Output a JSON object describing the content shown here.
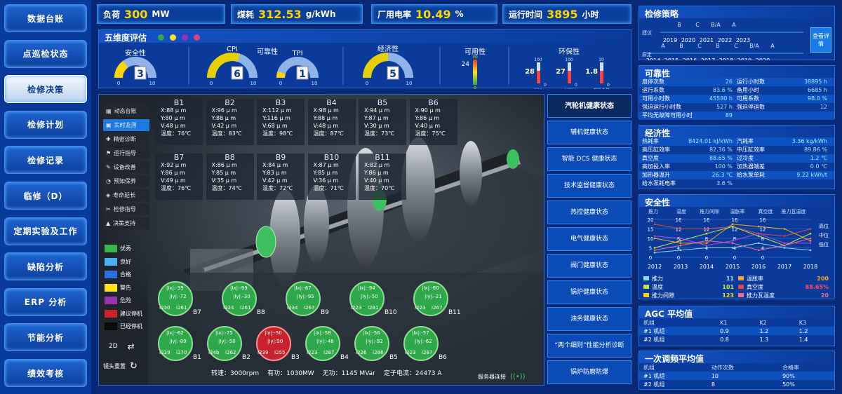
{
  "nav": [
    "数据台账",
    "点巡检状态",
    "检修决策",
    "检修计划",
    "检修记录",
    "临修（D）",
    "定期实验及工作",
    "缺陷分析",
    "ERP 分析",
    "节能分析",
    "绩效考核"
  ],
  "nav_active": 2,
  "metrics": [
    {
      "label": "负荷",
      "value": "300",
      "unit": "MW"
    },
    {
      "label": "煤耗",
      "value": "312.53",
      "unit": "g/kWh"
    },
    {
      "label": "厂用电率",
      "value": "10.49",
      "unit": "%"
    },
    {
      "label": "运行时间",
      "value": "3895",
      "unit": "小时"
    }
  ],
  "five": {
    "title": "五维度评估",
    "dots": [
      "#2fa84a",
      "#ffe21a",
      "#9b2fb5",
      "#e0407a"
    ],
    "safety": {
      "label": "安全性",
      "value": "3",
      "min": "0",
      "max": "10",
      "level": 0.3
    },
    "reliability": {
      "label": "可靠性",
      "cpi_label": "CPI",
      "cpi": "6",
      "tpi_label": "TPI",
      "tpi": "1",
      "min": "0",
      "max": "10",
      "cpi_level": 0.6,
      "tpi_level": 0.1
    },
    "economy": {
      "label": "经济性",
      "value": "5",
      "min": "0",
      "max": "10",
      "level": 0.5
    },
    "availability": {
      "label": "可用性",
      "value": "24",
      "top": "30",
      "bottom": "0",
      "level": 0.8
    },
    "env": {
      "label": "环保性",
      "items": [
        {
          "name": "SO2",
          "value": "28",
          "max": "100",
          "min": "0"
        },
        {
          "name": "NOX",
          "value": "27",
          "max": "100",
          "min": "0"
        },
        {
          "name": "烟尘含量",
          "value": "1.8",
          "max": "10",
          "min": "0"
        }
      ]
    }
  },
  "view_menu": [
    {
      "label": "动态台账",
      "icon": "grid-icon"
    },
    {
      "label": "实时监测",
      "icon": "monitor-icon"
    },
    {
      "label": "精密诊断",
      "icon": "stethoscope-icon"
    },
    {
      "label": "运行指导",
      "icon": "guide-icon"
    },
    {
      "label": "设备改善",
      "icon": "wrench-icon"
    },
    {
      "label": "预知保养",
      "icon": "gauge-icon"
    },
    {
      "label": "寿命延长",
      "icon": "shield-icon"
    },
    {
      "label": "检修指导",
      "icon": "tools-icon"
    },
    {
      "label": "决策支持",
      "icon": "decision-icon"
    }
  ],
  "view_menu_active": 1,
  "bearings": [
    {
      "name": "B1",
      "x": "X:88 μ m",
      "y": "Y:80 μ m",
      "v": "V:48 μ m",
      "t": "温度：76℃"
    },
    {
      "name": "B2",
      "x": "X:96 μ m",
      "y": "Y:88 μ m",
      "v": "V:42 μ m",
      "t": "温度：83℃"
    },
    {
      "name": "B3",
      "x": "X:112 μ m",
      "y": "Y:116 μ m",
      "v": "V:68 μ m",
      "t": "温度：98℃"
    },
    {
      "name": "B4",
      "x": "X:98 μ m",
      "y": "Y:88 μ m",
      "v": "V:48 μ m",
      "t": "温度：87℃"
    },
    {
      "name": "B5",
      "x": "X:94 μ m",
      "y": "Y:87 μ m",
      "v": "V:30 μ m",
      "t": "温度：73℃"
    },
    {
      "name": "B6",
      "x": "X:90 μ m",
      "y": "Y:86 μ m",
      "v": "V:40 μ m",
      "t": "温度：75℃"
    },
    {
      "name": "B7",
      "x": "X:92 μ m",
      "y": "Y:86 μ m",
      "v": "V:49 μ m",
      "t": "温度：76℃"
    },
    {
      "name": "B8",
      "x": "X:86 μ m",
      "y": "Y:85 μ m",
      "v": "V:35 μ m",
      "t": "温度：74℃"
    },
    {
      "name": "B9",
      "x": "X:84 μ m",
      "y": "Y:83 μ m",
      "v": "V:42 μ m",
      "t": "温度：72℃"
    },
    {
      "name": "B10",
      "x": "X:87 μ m",
      "y": "Y:85 μ m",
      "v": "V:36 μ m",
      "t": "温度：71℃"
    },
    {
      "name": "B11",
      "x": "X:82 μ m",
      "y": "Y:86 μ m",
      "v": "V:40 μ m",
      "t": "温度：70℃"
    }
  ],
  "legend": [
    {
      "label": "优秀",
      "color": "#35b84a"
    },
    {
      "label": "良好",
      "color": "#4ab0f0"
    },
    {
      "label": "合格",
      "color": "#2c6fe0"
    },
    {
      "label": "警告",
      "color": "#ffe21a"
    },
    {
      "label": "危险",
      "color": "#9b2fb5"
    },
    {
      "label": "建议停机",
      "color": "#d0202a"
    },
    {
      "label": "已经停机",
      "color": "#0a0a0a"
    }
  ],
  "circles": [
    {
      "name": "B7",
      "a": "|Ix|:-39",
      "b": "|Iy|:-72",
      "c": "I230",
      "d": "I261",
      "red": false
    },
    {
      "name": "B8",
      "a": "|Ix|:-99",
      "b": "|Iy|:-30",
      "c": "I224",
      "d": "I261",
      "red": false
    },
    {
      "name": "B9",
      "a": "|Ix|:-67",
      "b": "|Iy|:-95",
      "c": "I234",
      "d": "I267",
      "red": false
    },
    {
      "name": "B10",
      "a": "|Ix|:-94",
      "b": "|Iy|:-50",
      "c": "I223",
      "d": "I281",
      "red": false
    },
    {
      "name": "B11",
      "a": "|Ix|:-60",
      "b": "|Iy|:-21",
      "c": "I223",
      "d": "I267",
      "red": false
    },
    {
      "name": "B1",
      "a": "|Ix|:-62",
      "b": "|Iy|:-89",
      "c": "I229",
      "d": "I270",
      "red": false
    },
    {
      "name": "B2",
      "a": "|Ix|:-75",
      "b": "|Iy|:-50",
      "c": "I24b",
      "d": "I262",
      "red": false
    },
    {
      "name": "B3",
      "a": "|Ix|:-50",
      "b": "|Iy|:90",
      "c": "I239",
      "d": "I255",
      "red": true
    },
    {
      "name": "B4",
      "a": "|Ix|:-58",
      "b": "|Iy|:-48",
      "c": "I223",
      "d": "I287",
      "red": false
    },
    {
      "name": "B5",
      "a": "|Ix|:-56",
      "b": "|Iy|:-92",
      "c": "I226",
      "d": "I286",
      "red": false
    },
    {
      "name": "B6",
      "a": "|Ix|:-57",
      "b": "|Iy|:-62",
      "c": "I223",
      "d": "I287",
      "red": false
    }
  ],
  "view_2d": "2D",
  "view_reset": "镜头重置",
  "status_line": {
    "speed": "转速：3000rpm",
    "active": "有功：1030MW",
    "reactive": "无功：1145 MVar",
    "stator": "定子电流：24473 A"
  },
  "server": "服务器连接",
  "right_nav": [
    "汽轮机健康状态",
    "辅机健康状态",
    "智能 DCS 健康状态",
    "技术监督健康状态",
    "热控健康状态",
    "电气健康状态",
    "阀门健康状态",
    "锅炉健康状态",
    "油务健康状态",
    "“两个细则”性能分析诊断",
    "锅炉防磨防爆"
  ],
  "strategy": {
    "title": "检修策略",
    "suggest_label": "建议",
    "plan_label": "原定",
    "suggest_letters": [
      "B",
      "C",
      "B/A",
      "A"
    ],
    "suggest_years": [
      "2019",
      "2020",
      "2021",
      "2022",
      "2023"
    ],
    "plan_letters": [
      "A",
      "B",
      "C",
      "B",
      "C",
      "B/A",
      "A"
    ],
    "plan_years": [
      "2014",
      "2015",
      "2016",
      "2017",
      "2018",
      "2019",
      "2020"
    ],
    "button": "查看详情"
  },
  "reliability": {
    "title": "可靠性",
    "rows": [
      [
        "扇停次数",
        "26",
        "运行小时数",
        "38895 h"
      ],
      [
        "运行系数",
        "83.6 %",
        "备用小时",
        "6685 h"
      ],
      [
        "可用小时数",
        "45580 h",
        "可用系数",
        "98.0 %"
      ],
      [
        "强迫运行小时数",
        "527 h",
        "强迫停运数",
        "12"
      ],
      [
        "平均无故障可用小时",
        "89",
        "",
        ""
      ]
    ]
  },
  "economy": {
    "title": "经济性",
    "rows": [
      [
        "热耗率",
        "8424.01 kJ/kWh",
        "汽耗率",
        "3.36 kg/kWh"
      ],
      [
        "高压缸效率",
        "82.36 %",
        "中压缸效率",
        "89.86 %"
      ],
      [
        "真空度",
        "88.65 %",
        "过冷度",
        "1.2 ℃"
      ],
      [
        "高加投入率",
        "100 %",
        "加热器端差",
        "0.0 ℃"
      ],
      [
        "加热器温升",
        "26.3 ℃",
        "给水泵单耗",
        "9.22 kWh/t"
      ],
      [
        "给水泵耗电率",
        "3.6 %",
        "",
        ""
      ]
    ]
  },
  "safety": {
    "title": "安全性",
    "chart_data": {
      "type": "line",
      "x": [
        "2012",
        "2013",
        "2014",
        "2015",
        "2016",
        "2017",
        "2018"
      ],
      "columns": [
        "推力",
        "温度",
        "推力间隙",
        "温胀率",
        "真空度",
        "推力瓦温度"
      ],
      "yticks": [
        [
          "20",
          "16",
          "16",
          "16",
          "16"
        ],
        [
          "15",
          "12",
          "12",
          "12",
          "12"
        ],
        [
          "10",
          "8",
          "8",
          "8",
          "8"
        ],
        [
          "5",
          "4",
          "4",
          "4",
          "4"
        ],
        [
          "0",
          "0",
          "0",
          "0",
          "0"
        ]
      ],
      "right_labels": [
        "高位",
        "中位",
        "低位"
      ],
      "series": [
        {
          "name": "推力",
          "color": "#e04848",
          "values": [
            14,
            12,
            12,
            13,
            10,
            9,
            12
          ]
        },
        {
          "name": "温胀率",
          "color": "#f5a623",
          "values": [
            8,
            6,
            6,
            14,
            13,
            12,
            7
          ]
        },
        {
          "name": "温度",
          "color": "#c4e83a",
          "values": [
            4,
            7,
            10,
            13,
            9,
            5,
            10
          ]
        },
        {
          "name": "真空度",
          "color": "#b048e0",
          "values": [
            9,
            8,
            5,
            7,
            10,
            6,
            6
          ]
        },
        {
          "name": "推力间隙",
          "color": "#8ed8ff",
          "values": [
            2,
            3,
            4,
            4,
            6,
            4,
            3
          ]
        },
        {
          "name": "推力瓦温度",
          "color": "#f06a9a",
          "values": [
            3,
            5,
            7,
            6,
            3,
            5,
            8
          ]
        }
      ]
    },
    "legend": [
      {
        "name": "推力",
        "value": "11",
        "color": "#8ed8ff",
        "vcolor": "#9be8ff"
      },
      {
        "name": "温胀率",
        "value": "200",
        "color": "#f5a623",
        "vcolor": "#f5a623"
      },
      {
        "name": "温度",
        "value": "101",
        "color": "#c4e83a",
        "vcolor": "#c4e83a"
      },
      {
        "name": "真空度",
        "value": "88.65%",
        "color": "#e04848",
        "vcolor": "#ff4d6a"
      },
      {
        "name": "推力间隙",
        "value": "123",
        "color": "#ffd400",
        "vcolor": "#ffd400"
      },
      {
        "name": "推力瓦温度",
        "value": "20",
        "color": "#f06a9a",
        "vcolor": "#f06a9a"
      }
    ]
  },
  "agc": {
    "title": "AGC 平均值",
    "header": [
      "机组",
      "K1",
      "K2",
      "K3"
    ],
    "rows": [
      [
        "#1 机组",
        "0.9",
        "1.2",
        "1.2"
      ],
      [
        "#2 机组",
        "0.8",
        "1.3",
        "1.4"
      ]
    ]
  },
  "adjust": {
    "title": "一次调频平均值",
    "header": [
      "机组",
      "动作次数",
      "合格率"
    ],
    "rows": [
      [
        "#1 机组",
        "10",
        "90%"
      ],
      [
        "#2 机组",
        "8",
        "50%"
      ]
    ]
  }
}
